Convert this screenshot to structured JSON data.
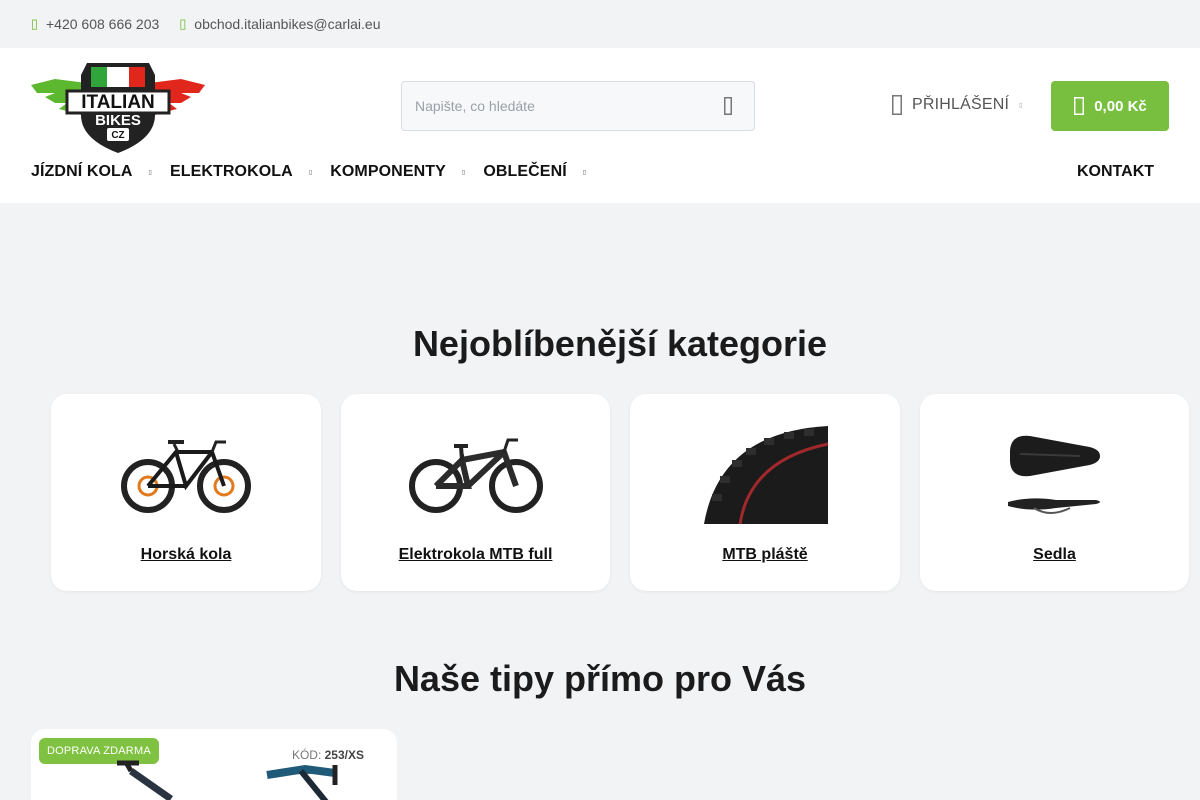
{
  "topbar": {
    "phone": "+420 608 666 203",
    "email": "obchod.italianbikes@carlai.eu",
    "phone_icon": "phone-icon",
    "email_icon": "mail-icon"
  },
  "logo": {
    "line1": "ITALIAN",
    "line2": "BIKES",
    "line3": "CZ"
  },
  "search": {
    "placeholder": "Napište, co hledáte",
    "icon": "search-icon"
  },
  "account": {
    "login_label": "PŘIHLÁŠENÍ",
    "icon": "user-icon"
  },
  "cart": {
    "total": "0,00 Kč",
    "icon": "bag-icon"
  },
  "nav": {
    "items": [
      {
        "label": "JÍZDNÍ KOLA"
      },
      {
        "label": "ELEKTROKOLA"
      },
      {
        "label": "KOMPONENTY"
      },
      {
        "label": "OBLEČENÍ"
      }
    ],
    "contact": "KONTAKT"
  },
  "categories": {
    "title": "Nejoblíbenější kategorie",
    "items": [
      {
        "label": "Horská kola",
        "icon": "mountain-bike-image"
      },
      {
        "label": "Elektrokola MTB full",
        "icon": "e-mtb-image"
      },
      {
        "label": "MTB pláště",
        "icon": "tire-image"
      },
      {
        "label": "Sedla",
        "icon": "saddle-image"
      }
    ]
  },
  "tips": {
    "title": "Naše tipy přímo pro Vás",
    "product": {
      "badge": "DOPRAVA ZDARMA",
      "code_label": "KÓD:",
      "code_value": "253/XS"
    }
  },
  "colors": {
    "accent_green": "#78bf3f",
    "logo_red": "#e1261c",
    "logo_green": "#2fa53a",
    "page_bg": "#f2f3f5"
  }
}
